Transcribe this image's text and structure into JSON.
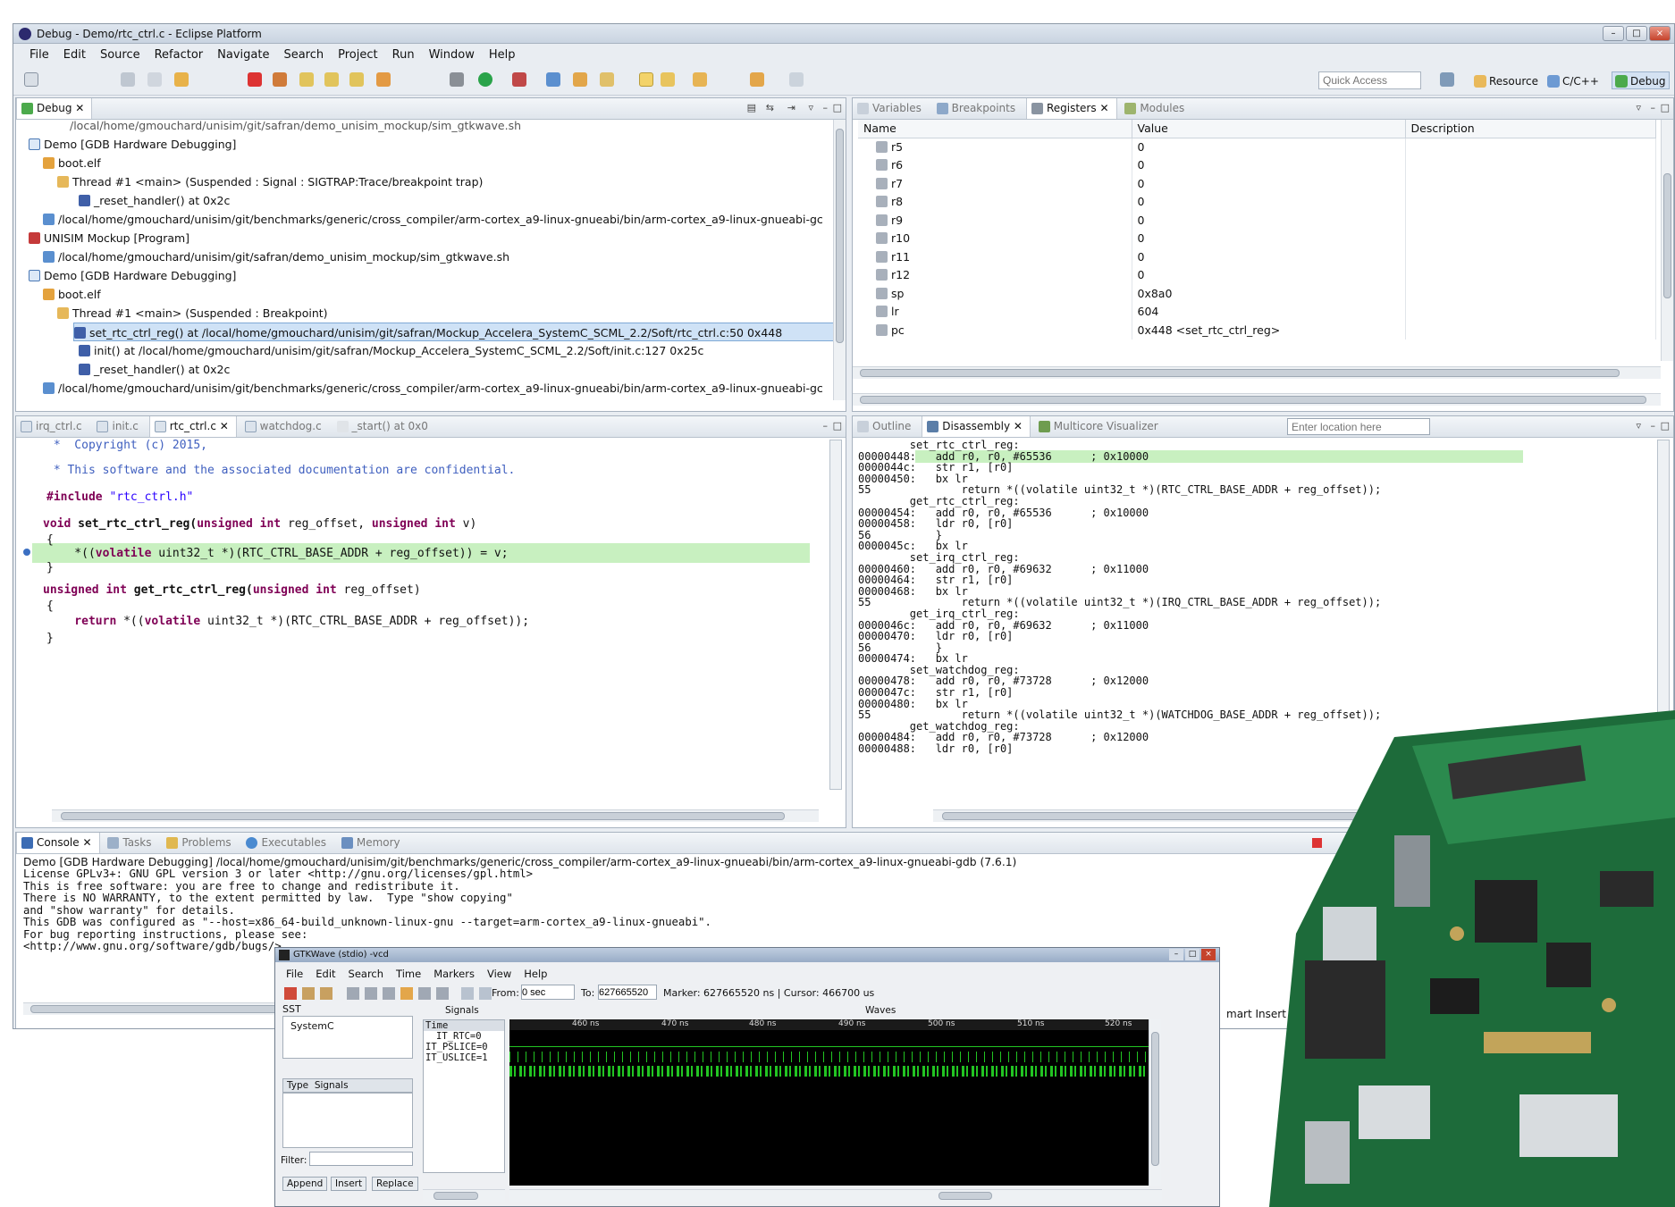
{
  "window": {
    "title": "Debug - Demo/rtc_ctrl.c - Eclipse Platform"
  },
  "menu": [
    "File",
    "Edit",
    "Source",
    "Refactor",
    "Navigate",
    "Search",
    "Project",
    "Run",
    "Window",
    "Help"
  ],
  "toolbar": {
    "quick_access_placeholder": "Quick Access",
    "perspectives": [
      "Resource",
      "C/C++",
      "Debug"
    ]
  },
  "debug_view": {
    "tab": "Debug",
    "rows": [
      "/local/home/gmouchard/unisim/git/safran/demo_unisim_mockup/sim_gtkwave.sh",
      "Demo [GDB Hardware Debugging]",
      "boot.elf",
      "Thread #1 <main> (Suspended : Signal : SIGTRAP:Trace/breakpoint trap)",
      "_reset_handler() at 0x2c",
      "/local/home/gmouchard/unisim/git/benchmarks/generic/cross_compiler/arm-cortex_a9-linux-gnueabi/bin/arm-cortex_a9-linux-gnueabi-gc",
      "UNISIM Mockup [Program]",
      "/local/home/gmouchard/unisim/git/safran/demo_unisim_mockup/sim_gtkwave.sh",
      "Demo [GDB Hardware Debugging]",
      "boot.elf",
      "Thread #1 <main> (Suspended : Breakpoint)",
      "set_rtc_ctrl_reg() at /local/home/gmouchard/unisim/git/safran/Mockup_Accelera_SystemC_SCML_2.2/Soft/rtc_ctrl.c:50 0x448",
      "init() at /local/home/gmouchard/unisim/git/safran/Mockup_Accelera_SystemC_SCML_2.2/Soft/init.c:127 0x25c",
      "_reset_handler() at 0x2c",
      "/local/home/gmouchard/unisim/git/benchmarks/generic/cross_compiler/arm-cortex_a9-linux-gnueabi/bin/arm-cortex_a9-linux-gnueabi-gc"
    ]
  },
  "registers_view": {
    "tabs": [
      "Variables",
      "Breakpoints",
      "Registers",
      "Modules"
    ],
    "columns": [
      "Name",
      "Value",
      "Description"
    ],
    "rows": [
      {
        "name": "r5",
        "value": "0"
      },
      {
        "name": "r6",
        "value": "0"
      },
      {
        "name": "r7",
        "value": "0"
      },
      {
        "name": "r8",
        "value": "0"
      },
      {
        "name": "r9",
        "value": "0"
      },
      {
        "name": "r10",
        "value": "0"
      },
      {
        "name": "r11",
        "value": "0"
      },
      {
        "name": "r12",
        "value": "0"
      },
      {
        "name": "sp",
        "value": "0x8a0"
      },
      {
        "name": "lr",
        "value": "604"
      },
      {
        "name": "pc",
        "value": "0x448 <set_rtc_ctrl_reg>"
      }
    ]
  },
  "editor": {
    "tabs": [
      "irq_ctrl.c",
      "init.c",
      "rtc_ctrl.c",
      "watchdog.c",
      "_start() at 0x0"
    ],
    "lines": {
      "l1": " *  Copyright (c) 2015,",
      "l2": " * This software and the associated documentation are confidential.",
      "l3_kw": "#include",
      "l3_str": " \"rtc_ctrl.h\"",
      "l4a": "void",
      "l4b": " set_rtc_ctrl_reg(",
      "l4c": "unsigned int",
      "l4d": " reg_offset, ",
      "l4e": "unsigned int",
      "l4f": " v)",
      "l5": "{",
      "l6a": "    *((",
      "l6b": "volatile",
      "l6c": " uint32_t *)(RTC_CTRL_BASE_ADDR + reg_offset)) = v;",
      "l7": "}",
      "l8a": "unsigned int",
      "l8b": " get_rtc_ctrl_reg(",
      "l8c": "unsigned int",
      "l8d": " reg_offset)",
      "l9": "{",
      "l10a": "    return",
      "l10b": " *((",
      "l10c": "volatile",
      "l10d": " uint32_t *)(RTC_CTRL_BASE_ADDR + reg_offset));",
      "l11": "}"
    }
  },
  "disassembly": {
    "tabs": [
      "Outline",
      "Disassembly",
      "Multicore Visualizer"
    ],
    "location_placeholder": "Enter location here",
    "text": "        set_rtc_ctrl_reg:\n00000448:   add r0, r0, #65536      ; 0x10000\n0000044c:   str r1, [r0]\n00000450:   bx lr\n55              return *((volatile uint32_t *)(RTC_CTRL_BASE_ADDR + reg_offset));\n        get_rtc_ctrl_reg:\n00000454:   add r0, r0, #65536      ; 0x10000\n00000458:   ldr r0, [r0]\n56          }\n0000045c:   bx lr\n        set_irq_ctrl_reg:\n00000460:   add r0, r0, #69632      ; 0x11000\n00000464:   str r1, [r0]\n00000468:   bx lr\n55              return *((volatile uint32_t *)(IRQ_CTRL_BASE_ADDR + reg_offset));\n        get_irq_ctrl_reg:\n0000046c:   add r0, r0, #69632      ; 0x11000\n00000470:   ldr r0, [r0]\n56          }\n00000474:   bx lr\n        set_watchdog_reg:\n00000478:   add r0, r0, #73728      ; 0x12000\n0000047c:   str r1, [r0]\n00000480:   bx lr\n55              return *((volatile uint32_t *)(WATCHDOG_BASE_ADDR + reg_offset));\n        get_watchdog_reg:\n00000484:   add r0, r0, #73728      ; 0x12000\n00000488:   ldr r0, [r0]"
  },
  "console": {
    "tabs": [
      "Console",
      "Tasks",
      "Problems",
      "Executables",
      "Memory"
    ],
    "header": "Demo [GDB Hardware Debugging] /local/home/gmouchard/unisim/git/benchmarks/generic/cross_compiler/arm-cortex_a9-linux-gnueabi/bin/arm-cortex_a9-linux-gnueabi-gdb (7.6.1)",
    "text": "License GPLv3+: GNU GPL version 3 or later <http://gnu.org/licenses/gpl.html>\nThis is free software: you are free to change and redistribute it.\nThere is NO WARRANTY, to the extent permitted by law.  Type \"show copying\"\nand \"show warranty\" for details.\nThis GDB was configured as \"--host=x86_64-build_unknown-linux-gnu --target=arm-cortex_a9-linux-gnueabi\".\nFor bug reporting instructions, please see:\n<http://www.gnu.org/software/gdb/bugs/>.",
    "status": "mart Insert"
  },
  "gtkwave": {
    "title": "GTKWave (stdio) -vcd",
    "menu": [
      "File",
      "Edit",
      "Search",
      "Time",
      "Markers",
      "View",
      "Help"
    ],
    "from_label": "From:",
    "from_value": "0 sec",
    "to_label": "To:",
    "to_value": "627665520",
    "marker": "Marker: 627665520 ns  |  Cursor: 466700 us",
    "sst": "SST",
    "tree_item": "SystemC",
    "type_col": "Type",
    "signals_col": "Signals",
    "filter_label": "Filter:",
    "buttons": [
      "Append",
      "Insert",
      "Replace"
    ],
    "signals_header": "Signals",
    "waves_header": "Waves",
    "time_label": "Time",
    "signal_list": [
      "IT_RTC=0",
      "IT_PSLICE=0",
      "IT_USLICE=1"
    ],
    "ticks": [
      "460 ns",
      "470 ns",
      "480 ns",
      "490 ns",
      "500 ns",
      "510 ns",
      "520 ns"
    ]
  }
}
